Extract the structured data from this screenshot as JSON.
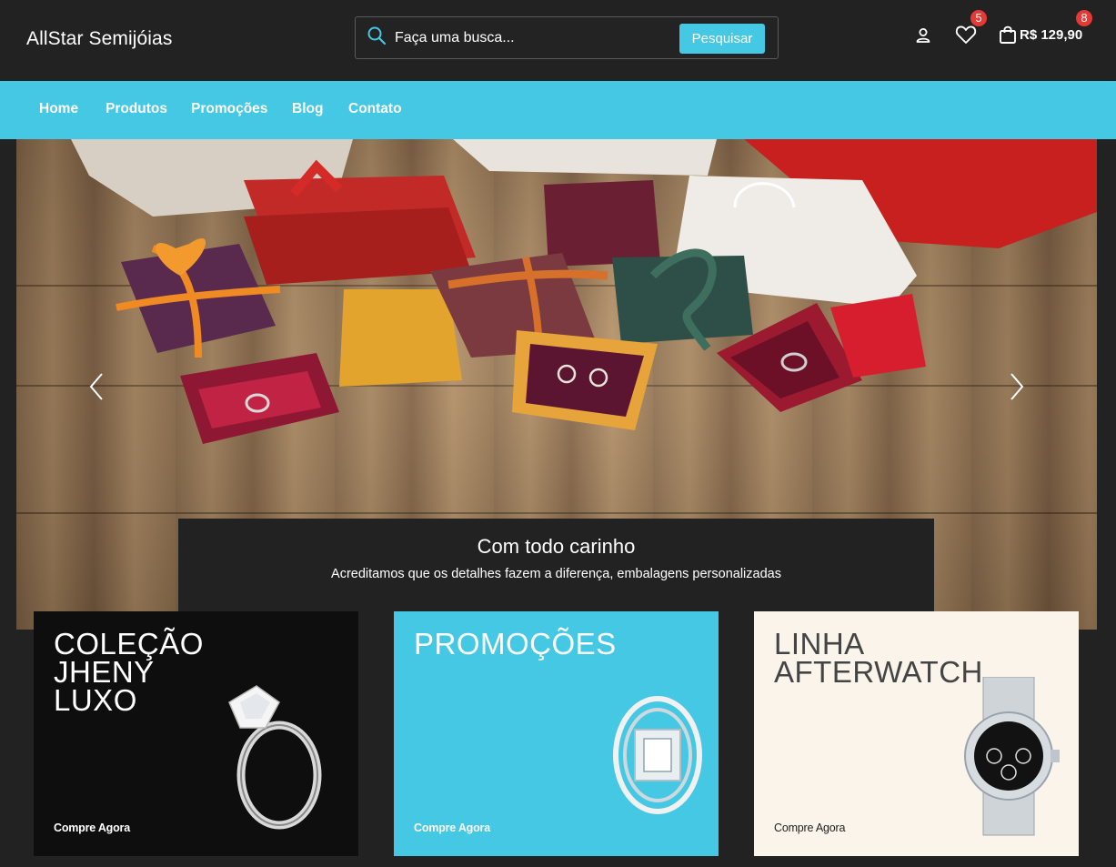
{
  "header": {
    "logo": "AllStar Semijóias",
    "search": {
      "placeholder": "Faça uma busca...",
      "button_label": "Pesquisar"
    },
    "wishlist_count": "5",
    "cart_count": "8",
    "cart_total": "R$ 129,90"
  },
  "nav": {
    "items": [
      {
        "label": "Home"
      },
      {
        "label": "Produtos"
      },
      {
        "label": "Promoções"
      },
      {
        "label": "Blog"
      },
      {
        "label": "Contato"
      }
    ]
  },
  "hero": {
    "title": "Com todo carinho",
    "subtitle": "Acreditamos que os detalhes fazem a diferença, embalagens personalizadas",
    "prev_icon": "chevron-left-icon",
    "next_icon": "chevron-right-icon"
  },
  "cards": [
    {
      "title_lines": [
        "COLEÇÃO",
        "JHENY",
        "LUXO"
      ],
      "cta": "Compre Agora",
      "image": "diamond-ring",
      "background": "#0e0e0e"
    },
    {
      "title_lines": [
        "PROMOÇÕES"
      ],
      "cta": "Compre Agora",
      "image": "diamond-cocktail-ring",
      "background": "#45c8e3"
    },
    {
      "title_lines": [
        "LINHA",
        "AFTERWATCH"
      ],
      "cta": "Compre Agora",
      "image": "silver-wristwatch",
      "background": "#fbf4ea"
    }
  ],
  "colors": {
    "accent": "#45c8e3",
    "dark": "#222222",
    "badge": "#e53935"
  }
}
